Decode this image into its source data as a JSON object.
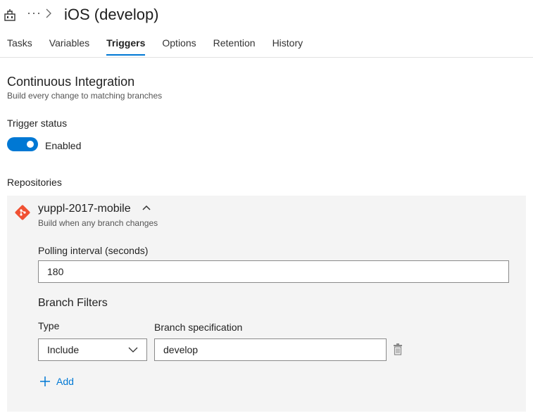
{
  "header": {
    "more_label": "···",
    "title": "iOS (develop)"
  },
  "tabs": [
    {
      "label": "Tasks",
      "active": false
    },
    {
      "label": "Variables",
      "active": false
    },
    {
      "label": "Triggers",
      "active": true
    },
    {
      "label": "Options",
      "active": false
    },
    {
      "label": "Retention",
      "active": false
    },
    {
      "label": "History",
      "active": false
    }
  ],
  "ci": {
    "title": "Continuous Integration",
    "subtitle": "Build every change to matching branches",
    "trigger_status_label": "Trigger status",
    "toggle_state": "Enabled"
  },
  "repositories": {
    "label": "Repositories",
    "repo_name": "yuppl-2017-mobile",
    "repo_subtitle": "Build when any branch changes",
    "polling_label": "Polling interval (seconds)",
    "polling_value": "180",
    "branch_filters_title": "Branch Filters",
    "type_label": "Type",
    "branch_spec_label": "Branch specification",
    "type_value": "Include",
    "branch_spec_value": "develop",
    "add_label": "Add"
  },
  "colors": {
    "accent": "#0078d4",
    "git": "#f05133",
    "panel": "#f4f4f4"
  },
  "icons": {
    "header": "build-pipeline-icon",
    "repo": "git-icon",
    "delete": "trash-icon",
    "add": "plus-icon"
  }
}
